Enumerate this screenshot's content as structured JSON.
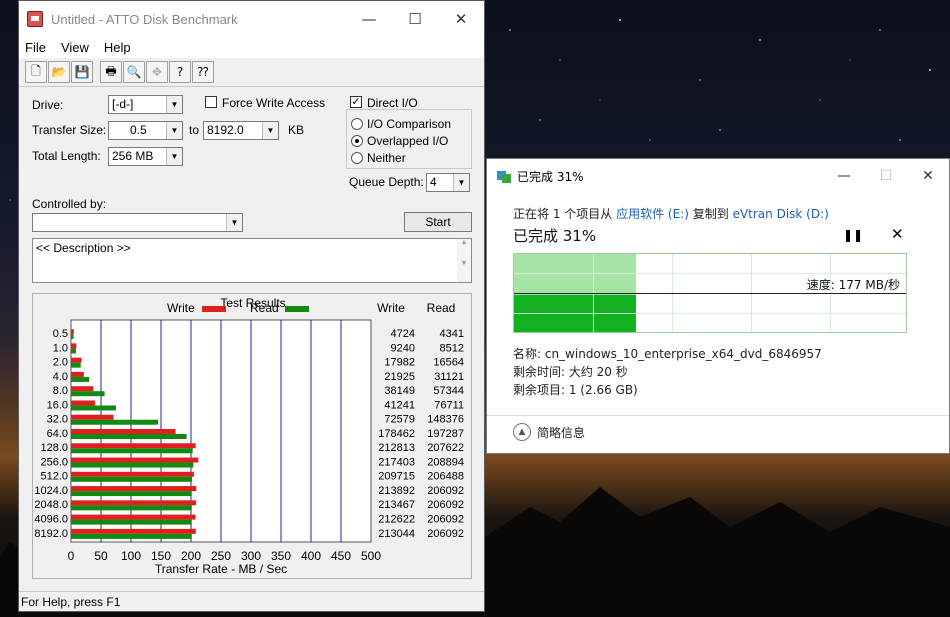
{
  "atto": {
    "title": "Untitled - ATTO Disk Benchmark",
    "window_controls": [
      "—",
      "☐",
      "✕"
    ],
    "menu": [
      "File",
      "View",
      "Help"
    ],
    "toolbar_icons": [
      "new-icon",
      "open-icon",
      "save-icon",
      "print-icon",
      "print-preview-icon",
      "move-icon",
      "help-icon",
      "context-help-icon"
    ],
    "drive_label": "Drive:",
    "drive_value": "[-d-]",
    "force_write_label": "Force Write Access",
    "direct_io_label": "Direct I/O",
    "direct_io_checked": true,
    "force_write_checked": false,
    "transfer_size_label": "Transfer Size:",
    "transfer_from": "0.5",
    "to_label": "to",
    "transfer_to": "8192.0",
    "kb_label": "KB",
    "total_length_label": "Total Length:",
    "total_length_value": "256 MB",
    "io_comparison_label": "I/O Comparison",
    "overlapped_io_label": "Overlapped I/O",
    "neither_label": "Neither",
    "selected_io_mode": "Overlapped I/O",
    "queue_depth_label": "Queue Depth:",
    "queue_depth_value": "4",
    "controlled_by_label": "Controlled by:",
    "controlled_by_value": "",
    "start_label": "Start",
    "description": "<< Description >>",
    "status": "For Help, press F1"
  },
  "chart_data": {
    "type": "bar",
    "title": "Test Results",
    "orientation": "horizontal",
    "categories": [
      "0.5",
      "1.0",
      "2.0",
      "4.0",
      "8.0",
      "16.0",
      "32.0",
      "64.0",
      "128.0",
      "256.0",
      "512.0",
      "1024.0",
      "2048.0",
      "4096.0",
      "8192.0"
    ],
    "series": [
      {
        "name": "Write",
        "color": "#e0201f",
        "values": [
          4724,
          9240,
          17982,
          21925,
          38149,
          41241,
          72579,
          178462,
          212813,
          217403,
          209715,
          213892,
          213467,
          212622,
          213044
        ]
      },
      {
        "name": "Read",
        "color": "#128a12",
        "values": [
          4341,
          8512,
          16564,
          31121,
          57344,
          76711,
          148376,
          197287,
          207622,
          208894,
          206488,
          206092,
          206092,
          206092,
          206092
        ]
      }
    ],
    "value_unit": "KB/s",
    "table_headers": [
      "Write",
      "Read"
    ],
    "xlabel": "Transfer Rate - MB / Sec",
    "xticks": [
      "0",
      "50",
      "100",
      "150",
      "200",
      "250",
      "300",
      "350",
      "400",
      "450",
      "500"
    ],
    "xlim": [
      0,
      500
    ],
    "legend": "top",
    "grid": true
  },
  "copy": {
    "title": "已完成 31%",
    "window_controls": [
      "—",
      "☐",
      "✕"
    ],
    "from_prefix": "正在将 1 个项目从",
    "source": "应用软件 (E:)",
    "copy_to": "复制到",
    "destination": "eVtran Disk (D:)",
    "percent_text": "已完成 31%",
    "percent": 31,
    "pause_icon": "pause-icon",
    "cancel_icon": "close-icon",
    "speed_text": "速度: 177 MB/秒",
    "name_text": "名称: cn_windows_10_enterprise_x64_dvd_6846957",
    "time_text": "剩余时间: 大约 20 秒",
    "items_text": "剩余项目: 1 (2.66 GB)",
    "details_label": "简略信息",
    "colors": {
      "graph_light": "#a6e3a6",
      "graph_dark": "#11b11f",
      "link": "#1a5fb4"
    }
  }
}
